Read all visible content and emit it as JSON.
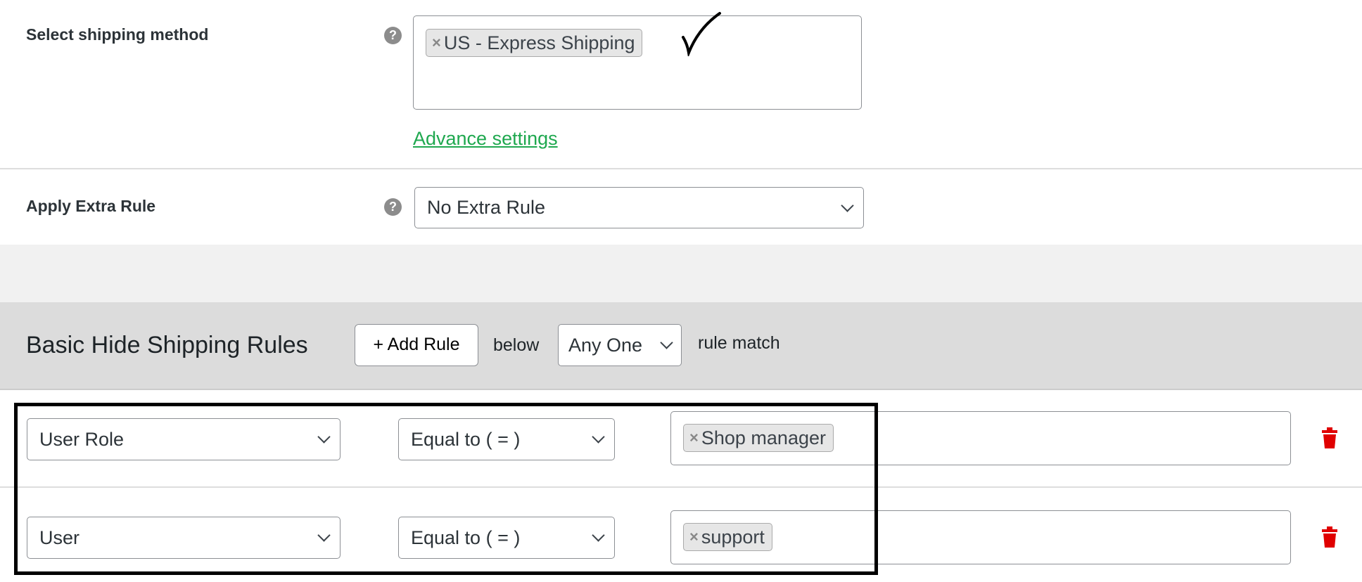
{
  "shipping_method": {
    "label": "Select shipping method",
    "help": "?",
    "tags": [
      "US - Express Shipping"
    ],
    "advance_link": "Advance settings"
  },
  "extra_rule": {
    "label": "Apply Extra Rule",
    "help": "?",
    "value": "No Extra Rule"
  },
  "rules": {
    "title": "Basic Hide Shipping Rules",
    "add_button": "+ Add Rule",
    "below": "below",
    "match_select": "Any One",
    "rule_match": "rule match",
    "rows": [
      {
        "field": "User Role",
        "operator": "Equal to ( = )",
        "tags": [
          "Shop manager"
        ]
      },
      {
        "field": "User",
        "operator": "Equal to ( = )",
        "tags": [
          "support"
        ]
      }
    ]
  },
  "colors": {
    "link": "#1fa84f",
    "delete": "#e00000",
    "header_bg": "#dcdcdc"
  }
}
